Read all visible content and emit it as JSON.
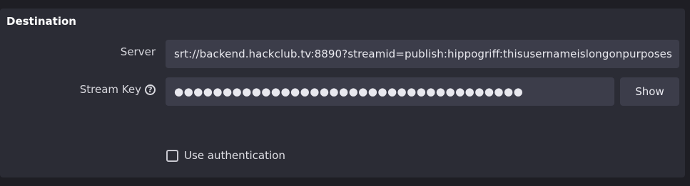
{
  "group": {
    "title": "Destination"
  },
  "server": {
    "label": "Server",
    "value": "srt://backend.hackclub.tv:8890?streamid=publish:hippogriff:thisusernameislongonpurposes"
  },
  "stream_key": {
    "label": "Stream Key",
    "help_icon": "question-circle-icon",
    "help_glyph": "?",
    "masked_value": "●●●●●●●●●●●●●●●●●●●●●●●●●●●●●●●●●●●●",
    "show_label": "Show"
  },
  "auth": {
    "label": "Use authentication",
    "checked": false
  }
}
